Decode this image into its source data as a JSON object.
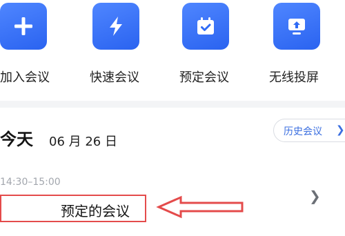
{
  "quick_actions": [
    {
      "label": "加入会议",
      "icon": "plus-icon"
    },
    {
      "label": "快速会议",
      "icon": "lightning-icon"
    },
    {
      "label": "预定会议",
      "icon": "calendar-check-icon"
    },
    {
      "label": "无线投屏",
      "icon": "screen-cast-icon"
    }
  ],
  "today": {
    "title": "今天",
    "date": "06 月 26 日"
  },
  "history_button": {
    "label": "历史会议",
    "icon": "chevron-right-icon"
  },
  "meeting": {
    "time": "14:30–15:00",
    "title": "预定的会议",
    "icon": "chevron-right-icon"
  },
  "colors": {
    "accent": "#2f6bf5",
    "annotation": "#e44b4b"
  }
}
